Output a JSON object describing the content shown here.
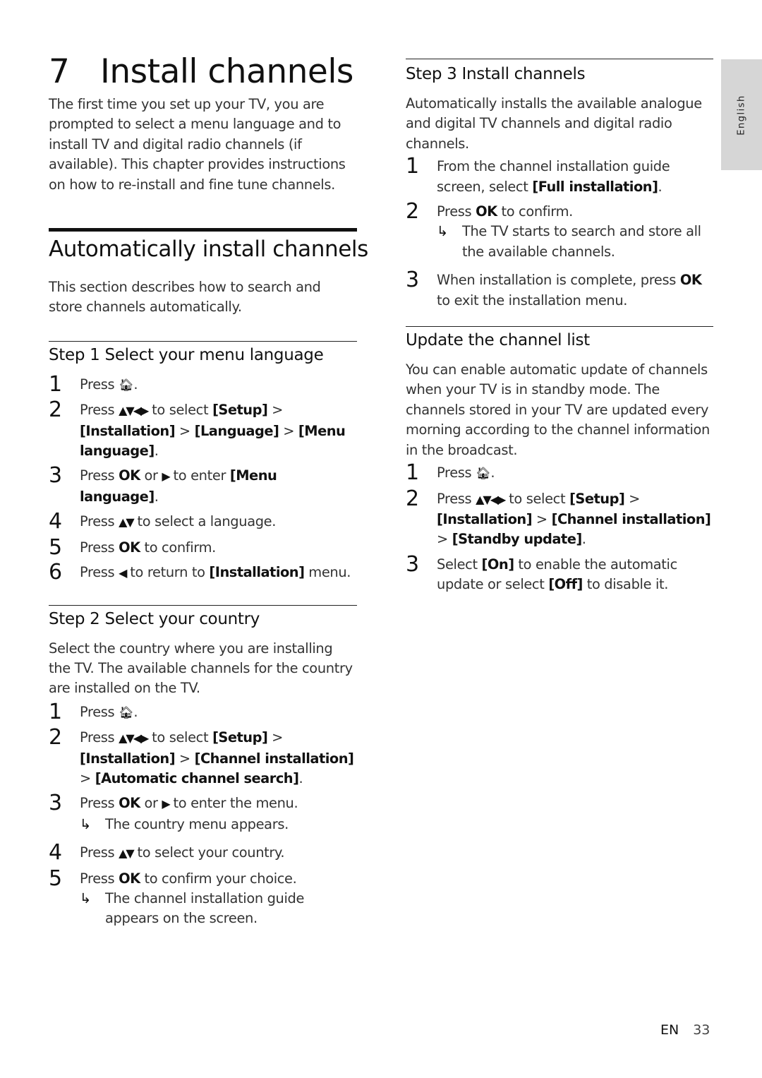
{
  "chapter": {
    "number": "7",
    "title": "Install channels",
    "intro": "The first time you set up your TV, you are prompted to select a menu language and to install TV and digital radio channels (if available). This chapter provides instructions on how to re-install and fine tune channels."
  },
  "auto_install": {
    "title": "Automatically install channels",
    "description": "This section describes how to search and store channels automatically."
  },
  "step1": {
    "title": "Step 1 Select your menu language",
    "items": [
      {
        "n": "1",
        "parts": [
          {
            "t": "Press "
          },
          {
            "icon": "home"
          },
          {
            "t": "."
          }
        ]
      },
      {
        "n": "2",
        "parts": [
          {
            "t": "Press "
          },
          {
            "icon": "nav4"
          },
          {
            "t": " to select "
          },
          {
            "b": "[Setup]"
          },
          {
            "t": " > "
          },
          {
            "b": "[Installation]"
          },
          {
            "t": " > "
          },
          {
            "b": "[Language]"
          },
          {
            "t": " > "
          },
          {
            "b": "[Menu language]"
          },
          {
            "t": "."
          }
        ]
      },
      {
        "n": "3",
        "parts": [
          {
            "t": "Press "
          },
          {
            "b": "OK"
          },
          {
            "t": " or "
          },
          {
            "icon": "right"
          },
          {
            "t": " to enter "
          },
          {
            "b": "[Menu language]"
          },
          {
            "t": "."
          }
        ]
      },
      {
        "n": "4",
        "parts": [
          {
            "t": "Press "
          },
          {
            "icon": "updown"
          },
          {
            "t": " to select a language."
          }
        ]
      },
      {
        "n": "5",
        "parts": [
          {
            "t": "Press "
          },
          {
            "b": "OK"
          },
          {
            "t": " to confirm."
          }
        ]
      },
      {
        "n": "6",
        "parts": [
          {
            "t": "Press "
          },
          {
            "icon": "left"
          },
          {
            "t": " to return to "
          },
          {
            "b": "[Installation]"
          },
          {
            "t": " menu."
          }
        ]
      }
    ]
  },
  "step2": {
    "title": "Step 2 Select your country",
    "description": "Select the country where you are installing the TV. The available channels for the country are installed on the TV.",
    "items": [
      {
        "n": "1",
        "parts": [
          {
            "t": "Press "
          },
          {
            "icon": "home"
          },
          {
            "t": "."
          }
        ]
      },
      {
        "n": "2",
        "parts": [
          {
            "t": "Press "
          },
          {
            "icon": "nav4"
          },
          {
            "t": " to select "
          },
          {
            "b": "[Setup]"
          },
          {
            "t": " > "
          },
          {
            "b": "[Installation]"
          },
          {
            "t": " > "
          },
          {
            "b": "[Channel installation]"
          },
          {
            "t": " > "
          },
          {
            "b": "[Automatic channel search]"
          },
          {
            "t": "."
          }
        ]
      },
      {
        "n": "3",
        "parts": [
          {
            "t": "Press "
          },
          {
            "b": "OK"
          },
          {
            "t": " or "
          },
          {
            "icon": "right"
          },
          {
            "t": " to enter the menu."
          }
        ],
        "result": "The country menu appears."
      },
      {
        "n": "4",
        "parts": [
          {
            "t": "Press "
          },
          {
            "icon": "updown"
          },
          {
            "t": " to select your country."
          }
        ]
      },
      {
        "n": "5",
        "parts": [
          {
            "t": "Press "
          },
          {
            "b": "OK"
          },
          {
            "t": " to confirm your choice."
          }
        ],
        "result": "The channel installation guide appears on the screen."
      }
    ]
  },
  "step3": {
    "title": "Step 3 Install channels",
    "description": "Automatically installs the available analogue and digital TV channels and digital radio channels.",
    "items": [
      {
        "n": "1",
        "parts": [
          {
            "t": "From the channel installation guide screen, select "
          },
          {
            "b": "[Full installation]"
          },
          {
            "t": "."
          }
        ]
      },
      {
        "n": "2",
        "parts": [
          {
            "t": "Press "
          },
          {
            "b": "OK"
          },
          {
            "t": " to confirm."
          }
        ],
        "result": "The TV starts to search and store all the available channels."
      },
      {
        "n": "3",
        "parts": [
          {
            "t": "When installation is complete, press "
          },
          {
            "b": "OK"
          },
          {
            "t": " to exit the installation menu."
          }
        ]
      }
    ]
  },
  "update": {
    "title": "Update the channel list",
    "description": "You can enable automatic update of channels when your TV is in standby mode. The channels stored in your TV are updated every morning according to the channel information in the broadcast.",
    "items": [
      {
        "n": "1",
        "parts": [
          {
            "t": "Press "
          },
          {
            "icon": "home"
          },
          {
            "t": "."
          }
        ]
      },
      {
        "n": "2",
        "parts": [
          {
            "t": "Press "
          },
          {
            "icon": "nav4"
          },
          {
            "t": " to select "
          },
          {
            "b": "[Setup]"
          },
          {
            "t": " > "
          },
          {
            "b": "[Installation]"
          },
          {
            "t": " > "
          },
          {
            "b": "[Channel installation]"
          },
          {
            "t": " > "
          },
          {
            "b": "[Standby update]"
          },
          {
            "t": "."
          }
        ]
      },
      {
        "n": "3",
        "parts": [
          {
            "t": "Select "
          },
          {
            "b": "[On]"
          },
          {
            "t": " to enable the automatic update or select "
          },
          {
            "b": "[Off]"
          },
          {
            "t": " to disable it."
          }
        ]
      }
    ]
  },
  "icons": {
    "home": "🏠︎",
    "nav4": "▲▼◀▶",
    "updown": "▲▼",
    "right": "▶",
    "left": "◀",
    "result_arrow": "↳"
  },
  "language_tab": "English",
  "footer": {
    "lang_code": "EN",
    "page_number": "33"
  }
}
